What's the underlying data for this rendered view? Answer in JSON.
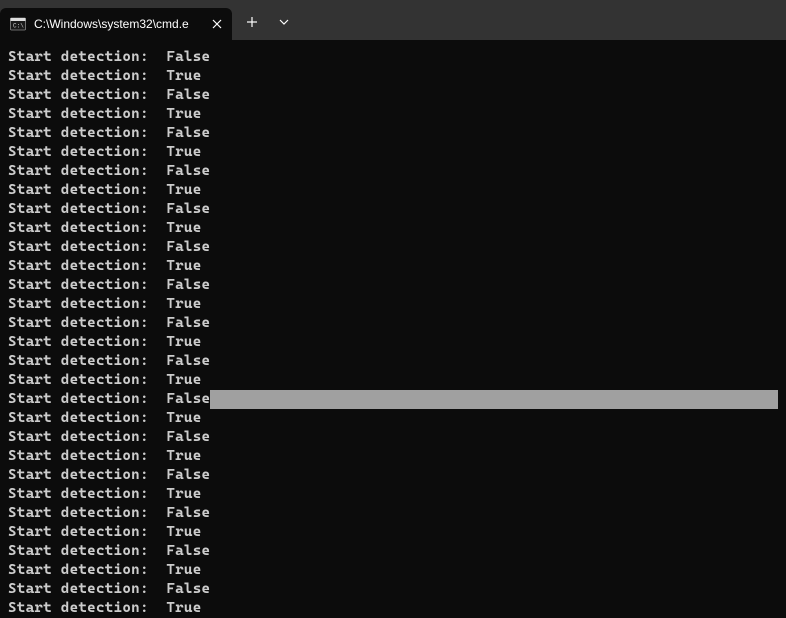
{
  "tab": {
    "title": "C:\\Windows\\system32\\cmd.e"
  },
  "terminal": {
    "label_prefix": "Start detection:",
    "highlighted_index": 18,
    "lines": [
      "False",
      "True",
      "False",
      "True",
      "False",
      "True",
      "False",
      "True",
      "False",
      "True",
      "False",
      "True",
      "False",
      "True",
      "False",
      "True",
      "False",
      "True",
      "False",
      "True",
      "False",
      "True",
      "False",
      "True",
      "False",
      "True",
      "False",
      "True",
      "False",
      "True"
    ]
  }
}
